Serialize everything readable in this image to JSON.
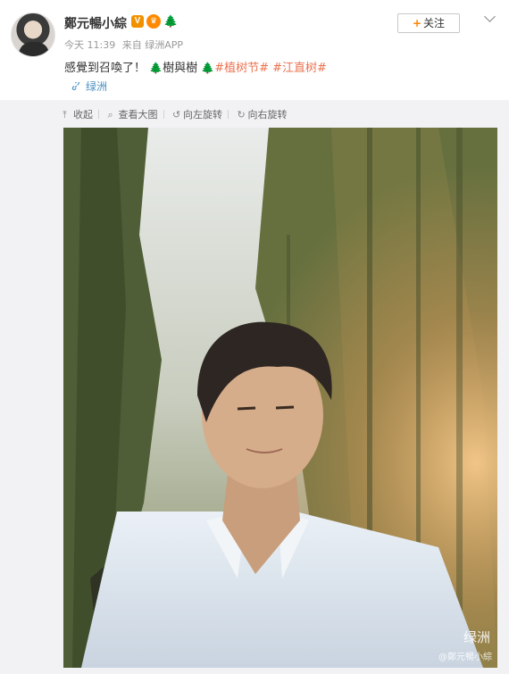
{
  "post": {
    "username": "鄭元暢小綜",
    "verified_badge": "V",
    "time": "今天 11:39",
    "source": "来自 绿洲APP",
    "follow_label": "关注",
    "text_lead": "感覺到召喚了！",
    "text_mid": "樹與樹",
    "tags": [
      "#植树节#",
      "#江直树#"
    ],
    "location": "绿洲"
  },
  "toolbar": {
    "collapse": "收起",
    "view_large": "查看大图",
    "rotate_left": "向左旋转",
    "rotate_right": "向右旋转"
  },
  "image": {
    "watermark_title": "绿洲",
    "watermark_user": "@鄭元暢小綜"
  },
  "colors": {
    "tag": "#eb7350",
    "link": "#4a90c2",
    "follow_plus": "#ff8200"
  },
  "icons": [
    "avatar",
    "verified-icon",
    "vip-crown-icon",
    "tree-icon",
    "chevron-down-icon",
    "link-icon",
    "collapse-icon",
    "search-icon",
    "rotate-left-icon",
    "rotate-right-icon"
  ]
}
